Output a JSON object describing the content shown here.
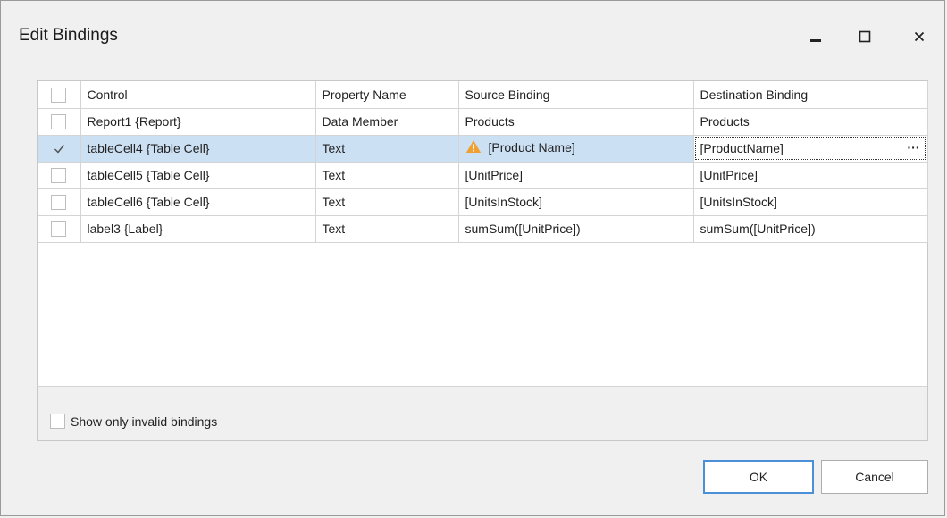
{
  "window": {
    "title": "Edit Bindings",
    "minimize_icon": "minimize-icon",
    "maximize_icon": "maximize-icon",
    "close_icon": "close-icon"
  },
  "grid": {
    "columns": [
      "Control",
      "Property Name",
      "Source Binding",
      "Destination Binding"
    ],
    "rows": [
      {
        "checked": false,
        "control": "Report1 {Report}",
        "property": "Data Member",
        "source": "Products",
        "destination": "Products",
        "warning": false
      },
      {
        "checked": true,
        "control": "tableCell4 {Table Cell}",
        "property": "Text",
        "source": "[Product Name]",
        "destination": "[ProductName]",
        "warning": true,
        "selected": true
      },
      {
        "checked": false,
        "control": "tableCell5 {Table Cell}",
        "property": "Text",
        "source": "[UnitPrice]",
        "destination": "[UnitPrice]",
        "warning": false
      },
      {
        "checked": false,
        "control": "tableCell6 {Table Cell}",
        "property": "Text",
        "source": "[UnitsInStock]",
        "destination": "[UnitsInStock]",
        "warning": false
      },
      {
        "checked": false,
        "control": "label3 {Label}",
        "property": "Text",
        "source": "sumSum([UnitPrice])",
        "destination": "sumSum([UnitPrice])",
        "warning": false
      }
    ],
    "ellipsis": "···"
  },
  "footer": {
    "show_invalid_label": "Show only invalid bindings",
    "show_invalid_checked": false
  },
  "buttons": {
    "ok": "OK",
    "cancel": "Cancel"
  },
  "colors": {
    "selected_row": "#cce0f4",
    "warning": "#f0a030",
    "ok_border": "#4a90d9"
  }
}
